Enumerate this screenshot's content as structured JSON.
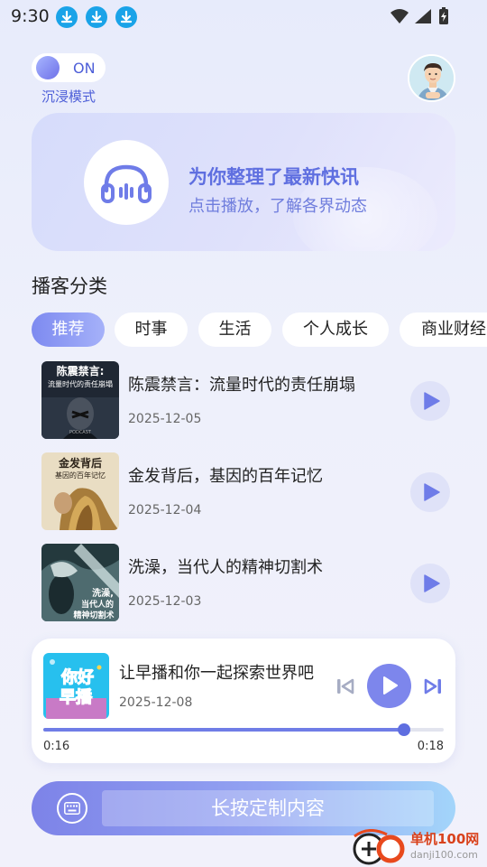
{
  "status_bar": {
    "time": "9:30"
  },
  "mode": {
    "toggle_text": "ON",
    "label": "沉浸模式"
  },
  "hero": {
    "title": "为你整理了最新快讯",
    "subtitle": "点击播放，了解各界动态"
  },
  "categories": {
    "title": "播客分类",
    "items": [
      "推荐",
      "时事",
      "生活",
      "个人成长",
      "商业财经"
    ],
    "active": "推荐"
  },
  "episodes": [
    {
      "title": "陈震禁言：流量时代的责任崩塌",
      "date": "2025-12-05",
      "cover_text_1": "陈震禁言:",
      "cover_text_2": "流量时代的责任崩塌",
      "cover_text_3": "PODCAST"
    },
    {
      "title": "金发背后，基因的百年记忆",
      "date": "2025-12-04",
      "cover_text_1": "金发背后",
      "cover_text_2": "基因的百年记忆"
    },
    {
      "title": "洗澡，当代人的精神切割术",
      "date": "2025-12-03",
      "cover_text_1": "洗澡,",
      "cover_text_2": "当代人的",
      "cover_text_3": "精神切割术"
    }
  ],
  "player": {
    "title": "让早播和你一起探索世界吧",
    "date": "2025-12-08",
    "cover_text_1": "你好",
    "cover_text_2": "早播",
    "current_time": "0:16",
    "duration": "0:18",
    "progress": 0.9
  },
  "custom": {
    "button_text": "长按定制内容"
  },
  "watermark": {
    "name": "单机100网",
    "url": "danji100.com"
  },
  "colors": {
    "accent": "#7d86ec",
    "status_download": "#1aa3e8"
  }
}
